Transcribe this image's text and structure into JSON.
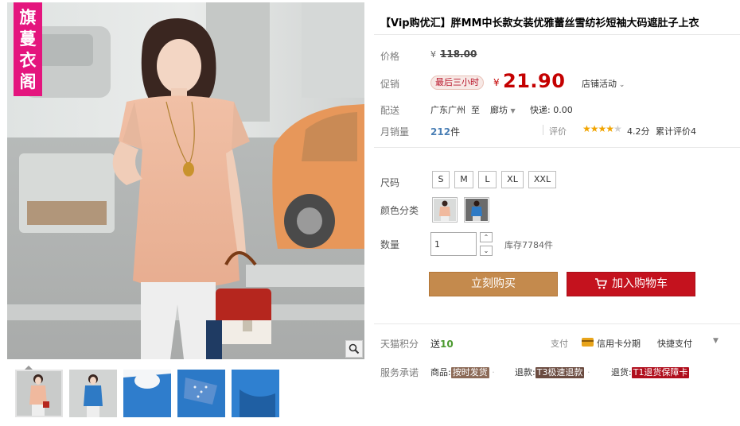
{
  "brand_logo": "旗蔓衣阁",
  "product": {
    "title": "【Vip购优汇】胖MM中长款女装优雅蕾丝雪纺衫短袖大码遮肚子上衣"
  },
  "price": {
    "label": "价格",
    "currency": "¥",
    "original": "118.00"
  },
  "promo": {
    "label": "促销",
    "badge": "最后三小时",
    "currency": "¥",
    "value": "21.90",
    "shop_activity": "店铺活动"
  },
  "delivery": {
    "label": "配送",
    "from": "广东广州",
    "to_word": "至",
    "to": "廊坊",
    "fee": "快递: 0.00"
  },
  "sales": {
    "label": "月销量",
    "count": "212",
    "unit": "件",
    "review_label": "评价",
    "stars": "★★★★",
    "half_star": "★",
    "rating_value": 4.2,
    "score": "4.2分",
    "review_count": "累计评价4"
  },
  "size": {
    "label": "尺码",
    "options": [
      "S",
      "M",
      "L",
      "XL",
      "XXL"
    ]
  },
  "color": {
    "label": "颜色分类",
    "options": [
      "pink-swatch",
      "blue-swatch"
    ]
  },
  "quantity": {
    "label": "数量",
    "value": "1",
    "stock": "库存7784件"
  },
  "actions": {
    "buy_now": "立刻购买",
    "add_cart": "加入购物车"
  },
  "points": {
    "label": "天猫积分",
    "give": "送",
    "amount": "10"
  },
  "payment": {
    "label": "支付",
    "installment": "信用卡分期",
    "quickpay": "快捷支付",
    "more": "▼"
  },
  "service": {
    "label": "服务承诺",
    "goods_label": "商品:",
    "goods_tag": "按时发货",
    "refund_label": "退款:",
    "refund_tag": "T3极速退款",
    "return_label": "退货:",
    "return_tag": "T1退货保障卡"
  },
  "colors": {
    "brand_pink": "#e4157e",
    "price_red": "#c40000",
    "buy_now": "#c48a4d",
    "add_cart": "#c4121e"
  },
  "thumbnails": [
    "thumb-pink-front",
    "thumb-blue-model",
    "thumb-blue-neckline",
    "thumb-blue-sleeve-lace",
    "thumb-blue-hem"
  ]
}
